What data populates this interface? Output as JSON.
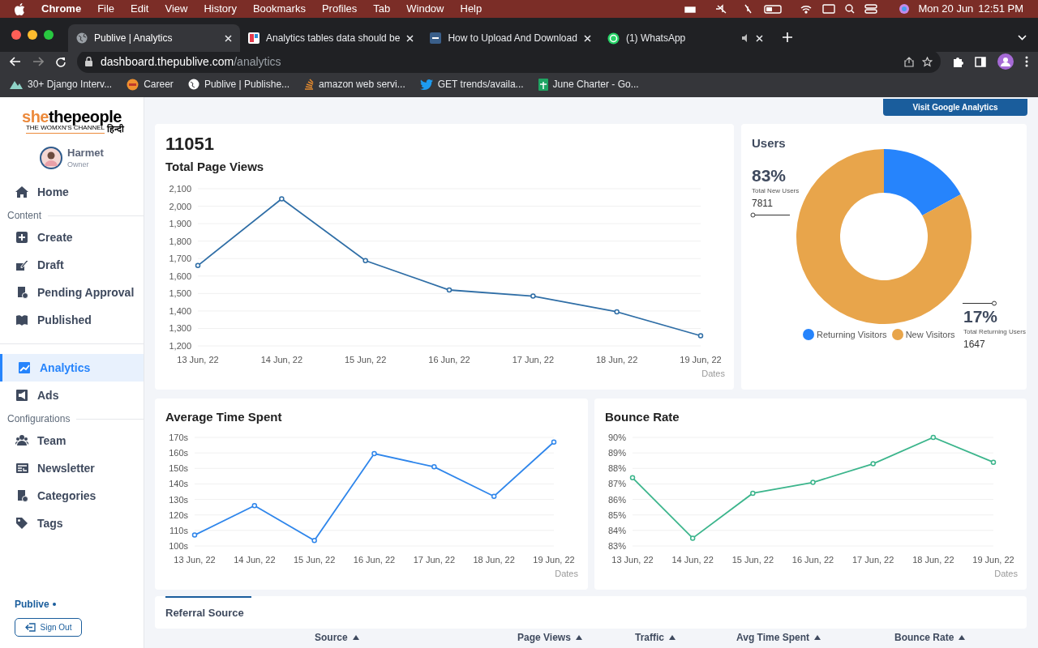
{
  "menu_bar": {
    "app": "Chrome",
    "items": [
      "File",
      "Edit",
      "View",
      "History",
      "Bookmarks",
      "Profiles",
      "Tab",
      "Window",
      "Help"
    ],
    "date": "Mon 20 Jun",
    "time": "12:51 PM"
  },
  "tabs": [
    {
      "title": "Publive | Analytics",
      "selected": true
    },
    {
      "title": "Analytics tables data should be",
      "selected": false
    },
    {
      "title": "How to Upload And Download",
      "selected": false
    },
    {
      "title": "(1) WhatsApp",
      "selected": false
    }
  ],
  "address": {
    "host": "dashboard.thepublive.com",
    "path": "/analytics"
  },
  "bookmarks": [
    "30+ Django Interv...",
    "Career",
    "Publive | Publishe...",
    "amazon web servi...",
    "GET trends/availa...",
    "June Charter - Go..."
  ],
  "sidebar": {
    "logo": {
      "accent": "she",
      "main": "thepeople",
      "tagline": "THE WOMXN'S CHANNEL",
      "script": "हिन्दी"
    },
    "user": {
      "name": "Harmet",
      "role": "Owner"
    },
    "nav": [
      {
        "kind": "item",
        "label": "Home",
        "selected": false
      },
      {
        "kind": "heading",
        "label": "Content"
      },
      {
        "kind": "item",
        "label": "Create",
        "selected": false
      },
      {
        "kind": "item",
        "label": "Draft",
        "selected": false
      },
      {
        "kind": "item",
        "label": "Pending Approval",
        "selected": false
      },
      {
        "kind": "item",
        "label": "Published",
        "selected": false
      },
      {
        "kind": "divider"
      },
      {
        "kind": "item",
        "label": "Analytics",
        "selected": true
      },
      {
        "kind": "item",
        "label": "Ads",
        "selected": false
      },
      {
        "kind": "heading",
        "label": "Configurations"
      },
      {
        "kind": "item",
        "label": "Team",
        "selected": false
      },
      {
        "kind": "item",
        "label": "Newsletter",
        "selected": false
      },
      {
        "kind": "item",
        "label": "Categories",
        "selected": false
      },
      {
        "kind": "item",
        "label": "Tags",
        "selected": false
      }
    ],
    "brand": "Publive",
    "sign_out": "Sign Out"
  },
  "ga_button": "Visit Google Analytics",
  "page_views": {
    "total": "11051",
    "title": "Total Page Views",
    "chart_data": {
      "type": "line",
      "xlabel": "Dates",
      "categories": [
        "13 Jun, 22",
        "14 Jun, 22",
        "15 Jun, 22",
        "16 Jun, 22",
        "17 Jun, 22",
        "18 Jun, 22",
        "19 Jun, 22"
      ],
      "ylim": [
        1200,
        2100
      ],
      "yticks": [
        {
          "value": 1200,
          "label": "1,200"
        },
        {
          "value": 1300,
          "label": "1,300"
        },
        {
          "value": 1400,
          "label": "1,400"
        },
        {
          "value": 1500,
          "label": "1,500"
        },
        {
          "value": 1600,
          "label": "1,600"
        },
        {
          "value": 1700,
          "label": "1,700"
        },
        {
          "value": 1800,
          "label": "1,800"
        },
        {
          "value": 1900,
          "label": "1,900"
        },
        {
          "value": 2000,
          "label": "2,000"
        },
        {
          "value": 2100,
          "label": "2,100"
        }
      ],
      "grid": true,
      "series": [
        {
          "color": "#2f6ea6",
          "marker": true,
          "values": [
            1660,
            2042,
            1688,
            1520,
            1485,
            1395,
            1258
          ]
        }
      ]
    }
  },
  "users": {
    "title": "Users",
    "new": {
      "percent": "83%",
      "label": "Total New Users",
      "count": "7811"
    },
    "returning": {
      "percent": "17%",
      "label": "Total Returning Users",
      "count": "1647"
    },
    "legend": [
      {
        "color": "#2684fc"
      },
      {
        "color": "#e8a54b"
      }
    ],
    "chart_data": {
      "type": "donut",
      "categories": [
        "Returning Visitors",
        "New Visitors"
      ],
      "values": [
        17,
        83
      ]
    }
  },
  "avg_time": {
    "title": "Average Time Spent",
    "chart_data": {
      "type": "line",
      "xlabel": "Dates",
      "categories": [
        "13 Jun, 22",
        "14 Jun, 22",
        "15 Jun, 22",
        "16 Jun, 22",
        "17 Jun, 22",
        "18 Jun, 22",
        "19 Jun, 22"
      ],
      "ylim": [
        100,
        170
      ],
      "yticks": [
        {
          "value": 100,
          "label": "100s"
        },
        {
          "value": 110,
          "label": "110s"
        },
        {
          "value": 120,
          "label": "120s"
        },
        {
          "value": 130,
          "label": "130s"
        },
        {
          "value": 140,
          "label": "140s"
        },
        {
          "value": 150,
          "label": "150s"
        },
        {
          "value": 160,
          "label": "160s"
        },
        {
          "value": 170,
          "label": "170s"
        }
      ],
      "grid": true,
      "series": [
        {
          "color": "#2f86eb",
          "marker": true,
          "values": [
            107,
            126,
            103.5,
            159.5,
            151,
            132,
            167
          ]
        }
      ]
    }
  },
  "bounce": {
    "title": "Bounce Rate",
    "chart_data": {
      "type": "line",
      "xlabel": "Dates",
      "categories": [
        "13 Jun, 22",
        "14 Jun, 22",
        "15 Jun, 22",
        "16 Jun, 22",
        "17 Jun, 22",
        "18 Jun, 22",
        "19 Jun, 22"
      ],
      "ylim": [
        83,
        90
      ],
      "yticks": [
        {
          "value": 83,
          "label": "83%"
        },
        {
          "value": 84,
          "label": "84%"
        },
        {
          "value": 85,
          "label": "85%"
        },
        {
          "value": 86,
          "label": "86%"
        },
        {
          "value": 87,
          "label": "87%"
        },
        {
          "value": 88,
          "label": "88%"
        },
        {
          "value": 89,
          "label": "89%"
        },
        {
          "value": 90,
          "label": "90%"
        }
      ],
      "grid": true,
      "series": [
        {
          "color": "#3cb58c",
          "marker": true,
          "values": [
            87.4,
            83.5,
            86.4,
            87.1,
            88.3,
            90,
            88.4
          ]
        }
      ]
    }
  },
  "referral": {
    "tabs": [
      {
        "label": "Referral Source",
        "selected": true
      }
    ],
    "columns": [
      "Source",
      "Page Views",
      "Traffic",
      "Avg Time Spent",
      "Bounce Rate"
    ]
  }
}
